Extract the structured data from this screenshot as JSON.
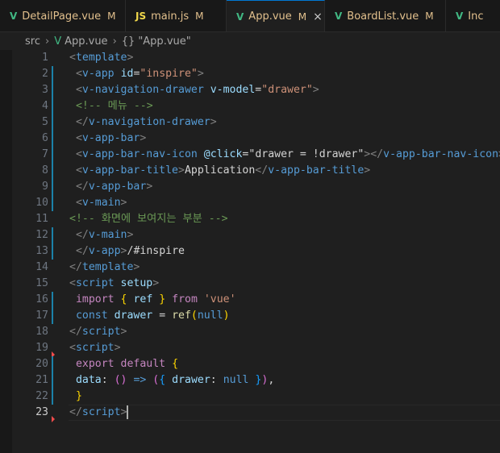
{
  "tabs": [
    {
      "name": "DetailPage.vue",
      "icon": "vue-icon",
      "modified": "M",
      "active": false
    },
    {
      "name": "main.js",
      "icon": "js-icon",
      "modified": "M",
      "active": false
    },
    {
      "name": "App.vue",
      "icon": "vue-icon",
      "modified": "M",
      "active": true
    },
    {
      "name": "BoardList.vue",
      "icon": "vue-icon",
      "modified": "M",
      "active": false
    },
    {
      "name": "Inc",
      "icon": "vue-icon",
      "modified": "",
      "active": false
    }
  ],
  "icons": {
    "vue": "V",
    "js": "JS",
    "close": "×",
    "chevron": "›",
    "braces": "{}"
  },
  "breadcrumb": {
    "folder": "src",
    "file": "App.vue",
    "symbol": "\"App.vue\""
  },
  "editor": {
    "current_line": 23,
    "lines": [
      {
        "n": "1",
        "tokens": [
          [
            "t-gray",
            "<"
          ],
          [
            "t-tag",
            "template"
          ],
          [
            "t-gray",
            ">"
          ]
        ]
      },
      {
        "n": "2",
        "tokens": [
          [
            "t-text",
            " "
          ],
          [
            "t-gray",
            "<"
          ],
          [
            "t-tag",
            "v-app"
          ],
          [
            "t-text",
            " "
          ],
          [
            "t-attr",
            "id"
          ],
          [
            "t-text",
            "="
          ],
          [
            "t-str",
            "\"inspire\""
          ],
          [
            "t-gray",
            ">"
          ]
        ]
      },
      {
        "n": "3",
        "tokens": [
          [
            "t-text",
            " "
          ],
          [
            "t-gray",
            "<"
          ],
          [
            "t-tag",
            "v-navigation-drawer"
          ],
          [
            "t-text",
            " "
          ],
          [
            "t-attr",
            "v-model"
          ],
          [
            "t-text",
            "="
          ],
          [
            "t-str",
            "\"drawer\""
          ],
          [
            "t-gray",
            ">"
          ]
        ]
      },
      {
        "n": "4",
        "tokens": [
          [
            "t-text",
            " "
          ],
          [
            "t-cmt",
            "<!-- 메뉴 -->"
          ]
        ]
      },
      {
        "n": "5",
        "tokens": [
          [
            "t-text",
            " "
          ],
          [
            "t-gray",
            "</"
          ],
          [
            "t-tag",
            "v-navigation-drawer"
          ],
          [
            "t-gray",
            ">"
          ]
        ]
      },
      {
        "n": "6",
        "tokens": [
          [
            "t-text",
            " "
          ],
          [
            "t-gray",
            "<"
          ],
          [
            "t-tag",
            "v-app-bar"
          ],
          [
            "t-gray",
            ">"
          ]
        ]
      },
      {
        "n": "7",
        "tokens": [
          [
            "t-text",
            " "
          ],
          [
            "t-gray",
            "<"
          ],
          [
            "t-tag",
            "v-app-bar-nav-icon"
          ],
          [
            "t-text",
            " "
          ],
          [
            "t-attr",
            "@click"
          ],
          [
            "t-text",
            "="
          ],
          [
            "t-text",
            "\"drawer = !drawer\""
          ],
          [
            "t-gray",
            "></"
          ],
          [
            "t-tag",
            "v-app-bar-nav-icon"
          ],
          [
            "t-gray",
            ">"
          ]
        ]
      },
      {
        "n": "8",
        "tokens": [
          [
            "t-text",
            " "
          ],
          [
            "t-gray",
            "<"
          ],
          [
            "t-tag",
            "v-app-bar-title"
          ],
          [
            "t-gray",
            ">"
          ],
          [
            "t-text",
            "Application"
          ],
          [
            "t-gray",
            "</"
          ],
          [
            "t-tag",
            "v-app-bar-title"
          ],
          [
            "t-gray",
            ">"
          ]
        ]
      },
      {
        "n": "9",
        "tokens": [
          [
            "t-text",
            " "
          ],
          [
            "t-gray",
            "</"
          ],
          [
            "t-tag",
            "v-app-bar"
          ],
          [
            "t-gray",
            ">"
          ]
        ]
      },
      {
        "n": "10",
        "tokens": [
          [
            "t-text",
            " "
          ],
          [
            "t-gray",
            "<"
          ],
          [
            "t-tag",
            "v-main"
          ],
          [
            "t-gray",
            ">"
          ]
        ]
      },
      {
        "n": "11",
        "tokens": [
          [
            "t-cmt",
            "<!-- 화면에 보여지는 부분 -->"
          ]
        ]
      },
      {
        "n": "12",
        "tokens": [
          [
            "t-text",
            " "
          ],
          [
            "t-gray",
            "</"
          ],
          [
            "t-tag",
            "v-main"
          ],
          [
            "t-gray",
            ">"
          ]
        ]
      },
      {
        "n": "13",
        "tokens": [
          [
            "t-text",
            " "
          ],
          [
            "t-gray",
            "</"
          ],
          [
            "t-tag",
            "v-app"
          ],
          [
            "t-gray",
            ">"
          ],
          [
            "t-text",
            "/#inspire"
          ]
        ]
      },
      {
        "n": "14",
        "tokens": [
          [
            "t-gray",
            "</"
          ],
          [
            "t-tag",
            "template"
          ],
          [
            "t-gray",
            ">"
          ]
        ]
      },
      {
        "n": "15",
        "tokens": [
          [
            "t-gray",
            "<"
          ],
          [
            "t-tag",
            "script"
          ],
          [
            "t-text",
            " "
          ],
          [
            "t-attr",
            "setup"
          ],
          [
            "t-gray",
            ">"
          ]
        ]
      },
      {
        "n": "16",
        "tokens": [
          [
            "t-text",
            " "
          ],
          [
            "t-kw",
            "import"
          ],
          [
            "t-text",
            " "
          ],
          [
            "t-gold",
            "{"
          ],
          [
            "t-text",
            " "
          ],
          [
            "t-var",
            "ref"
          ],
          [
            "t-text",
            " "
          ],
          [
            "t-gold",
            "}"
          ],
          [
            "t-text",
            " "
          ],
          [
            "t-kw",
            "from"
          ],
          [
            "t-text",
            " "
          ],
          [
            "t-str",
            "'vue'"
          ]
        ]
      },
      {
        "n": "17",
        "tokens": [
          [
            "t-text",
            " "
          ],
          [
            "t-dec",
            "const"
          ],
          [
            "t-text",
            " "
          ],
          [
            "t-var",
            "drawer"
          ],
          [
            "t-text",
            " = "
          ],
          [
            "t-fn",
            "ref"
          ],
          [
            "t-gold",
            "("
          ],
          [
            "t-dec",
            "null"
          ],
          [
            "t-gold",
            ")"
          ]
        ]
      },
      {
        "n": "18",
        "tokens": [
          [
            "t-gray",
            "</"
          ],
          [
            "t-tag",
            "script"
          ],
          [
            "t-gray",
            ">"
          ]
        ]
      },
      {
        "n": "19",
        "tokens": [
          [
            "t-gray",
            "<"
          ],
          [
            "t-tag",
            "script"
          ],
          [
            "t-gray",
            ">"
          ]
        ]
      },
      {
        "n": "20",
        "tokens": [
          [
            "t-text",
            " "
          ],
          [
            "t-kw",
            "export"
          ],
          [
            "t-text",
            " "
          ],
          [
            "t-kw",
            "default"
          ],
          [
            "t-text",
            " "
          ],
          [
            "t-gold",
            "{"
          ]
        ]
      },
      {
        "n": "21",
        "tokens": [
          [
            "t-text",
            " "
          ],
          [
            "t-var",
            "data"
          ],
          [
            "t-text",
            ": "
          ],
          [
            "t-pink",
            "()"
          ],
          [
            "t-text",
            " "
          ],
          [
            "t-dec",
            "=>"
          ],
          [
            "t-text",
            " "
          ],
          [
            "t-pink",
            "("
          ],
          [
            "t-blue2",
            "{"
          ],
          [
            "t-text",
            " "
          ],
          [
            "t-var",
            "drawer"
          ],
          [
            "t-text",
            ": "
          ],
          [
            "t-dec",
            "null"
          ],
          [
            "t-text",
            " "
          ],
          [
            "t-blue2",
            "}"
          ],
          [
            "t-pink",
            ")"
          ],
          [
            "t-text",
            ","
          ]
        ]
      },
      {
        "n": "22",
        "tokens": [
          [
            "t-text",
            " "
          ],
          [
            "t-gold",
            "}"
          ]
        ]
      },
      {
        "n": "23",
        "tokens": [
          [
            "t-gray",
            "</"
          ],
          [
            "t-tag",
            "script"
          ],
          [
            "t-gray",
            ">"
          ]
        ]
      }
    ]
  },
  "colors": {
    "accent": "#0078d4",
    "modified": "#e2c08d",
    "vue": "#41b883",
    "js": "#f1d84b"
  }
}
